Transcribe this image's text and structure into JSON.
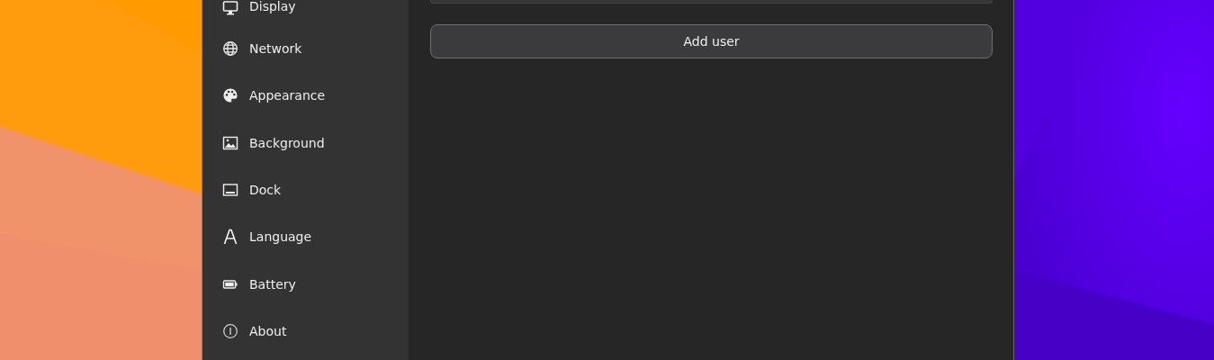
{
  "sidebar": {
    "items": [
      {
        "label": "Display",
        "selected": false
      },
      {
        "label": "Network",
        "selected": false
      },
      {
        "label": "Appearance",
        "selected": false
      },
      {
        "label": "Background",
        "selected": false
      },
      {
        "label": "Dock",
        "selected": false
      },
      {
        "label": "Language",
        "selected": false
      },
      {
        "label": "Battery",
        "selected": false
      },
      {
        "label": "About",
        "selected": false
      }
    ]
  },
  "content": {
    "add_button": "Add user"
  }
}
